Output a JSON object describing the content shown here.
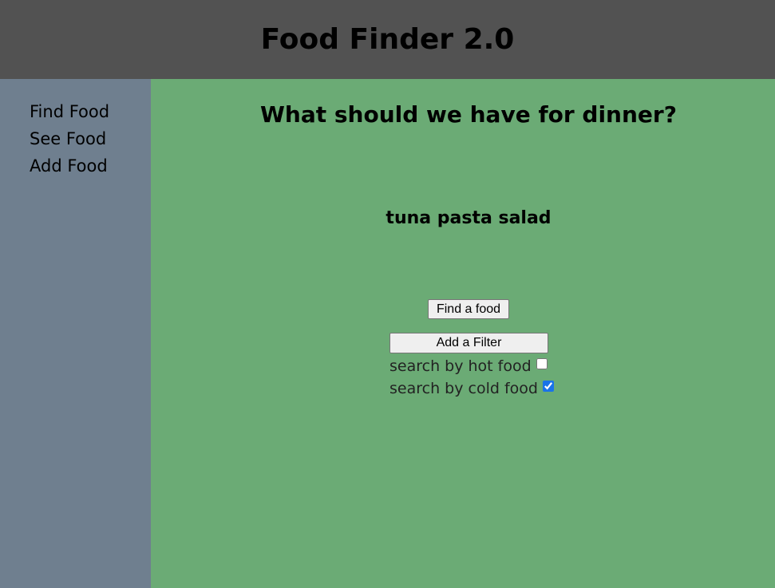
{
  "header": {
    "title": "Food Finder 2.0"
  },
  "sidebar": {
    "items": [
      {
        "label": "Find Food"
      },
      {
        "label": "See Food"
      },
      {
        "label": "Add Food"
      }
    ]
  },
  "main": {
    "title": "What should we have for dinner?",
    "result": "tuna pasta salad",
    "find_button": "Find a food",
    "filter_button": "Add a Filter",
    "filters": [
      {
        "label": "search by hot food",
        "checked": false
      },
      {
        "label": "search by cold food",
        "checked": true
      }
    ]
  },
  "colors": {
    "header_bg": "#525252",
    "sidebar_bg": "#6f7f8f",
    "main_bg": "#6bab75"
  }
}
